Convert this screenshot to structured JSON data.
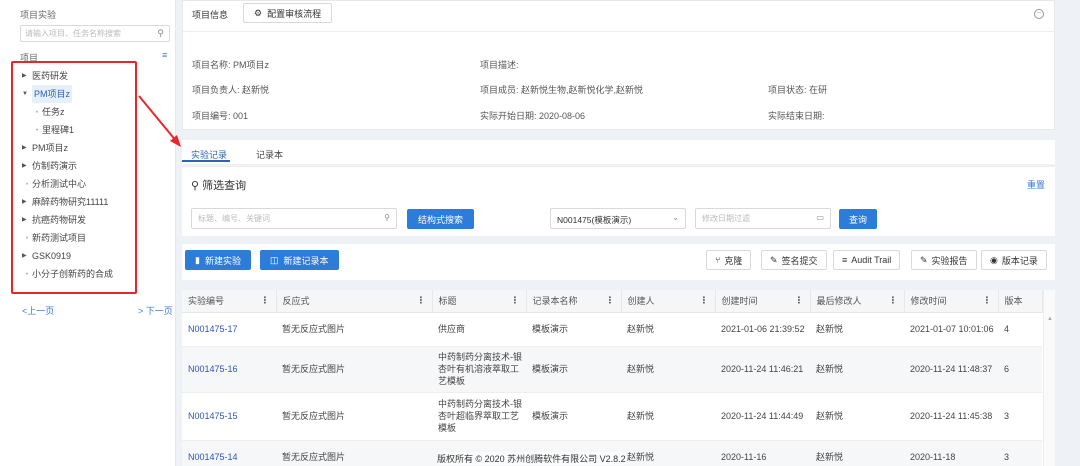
{
  "sidebar": {
    "title": "项目实验",
    "search_placeholder": "请输入项目、任务名称搜索",
    "section_label": "项目",
    "items": [
      {
        "label": "医药研发",
        "kind": "caret"
      },
      {
        "label": "PM项目z",
        "kind": "open"
      },
      {
        "label": "任务z",
        "kind": "child"
      },
      {
        "label": "里程碑1",
        "kind": "child"
      },
      {
        "label": "PM项目z",
        "kind": "caret"
      },
      {
        "label": "仿制药演示",
        "kind": "caret"
      },
      {
        "label": "分析测试中心",
        "kind": "dot"
      },
      {
        "label": "麻醉药物研究11111",
        "kind": "caret"
      },
      {
        "label": "抗癌药物研发",
        "kind": "caret"
      },
      {
        "label": "新药测试项目",
        "kind": "dot"
      },
      {
        "label": "GSK0919",
        "kind": "caret"
      },
      {
        "label": "小分子创新药的合成",
        "kind": "dot"
      }
    ],
    "prev_page": "<上一页",
    "next_page": "> 下一页"
  },
  "info": {
    "tab_label": "项目信息",
    "flow_button": "配置审核流程",
    "name": "项目名称: PM项目z",
    "desc": "项目描述:",
    "leader": "项目负责人: 赵新悦",
    "members": "项目成员: 赵新悦生物,赵新悦化学,赵新悦",
    "status": "项目状态: 在研",
    "code": "项目编号: 001",
    "start_date": "实际开始日期: 2020-08-06",
    "end_date": "实际结束日期:"
  },
  "tabs": {
    "records": "实验记录",
    "notebooks": "记录本"
  },
  "filter": {
    "title": "筛选查询",
    "reset": "重置",
    "keyword_placeholder": "标题、编号、关键词",
    "struct_search": "结构式搜索",
    "notebook_select": "N001475(模板演示)",
    "date_placeholder": "修改日期过滤",
    "query": "查询"
  },
  "toolbar": {
    "new_experiment": "新建实验",
    "new_notebook": "新建记录本",
    "clone": "克隆",
    "sign_submit": "签名提交",
    "audit_trail": "Audit Trail",
    "report": "实验报告",
    "version": "版本记录"
  },
  "table": {
    "headers": [
      "实验编号",
      "反应式",
      "标题",
      "记录本名称",
      "创建人",
      "创建时间",
      "最后修改人",
      "修改时间",
      "版本"
    ],
    "rows": [
      {
        "id": "N001475-17",
        "rxn": "暂无反应式图片",
        "title": "供应商",
        "notebook": "模板演示",
        "creator": "赵新悦",
        "created": "2021-01-06 21:39:52",
        "modifier": "赵新悦",
        "modified": "2021-01-07 10:01:06",
        "version": "4"
      },
      {
        "id": "N001475-16",
        "rxn": "暂无反应式图片",
        "title": "中药制药分离技术-银杏叶有机溶液萃取工艺模板",
        "notebook": "模板演示",
        "creator": "赵新悦",
        "created": "2020-11-24 11:46:21",
        "modifier": "赵新悦",
        "modified": "2020-11-24 11:48:37",
        "version": "6"
      },
      {
        "id": "N001475-15",
        "rxn": "暂无反应式图片",
        "title": "中药制药分离技术-银杏叶超临界萃取工艺模板",
        "notebook": "模板演示",
        "creator": "赵新悦",
        "created": "2020-11-24 11:44:49",
        "modifier": "赵新悦",
        "modified": "2020-11-24 11:45:38",
        "version": "3"
      },
      {
        "id": "N001475-14",
        "rxn": "暂无反应式图片",
        "title": "",
        "notebook": "",
        "creator": "赵新悦",
        "created": "2020-11-16",
        "modifier": "赵新悦",
        "modified": "2020-11-18",
        "version": "3"
      }
    ]
  },
  "watermark": "版权所有 © 2020 苏州创腾软件有限公司  V2.8.2"
}
